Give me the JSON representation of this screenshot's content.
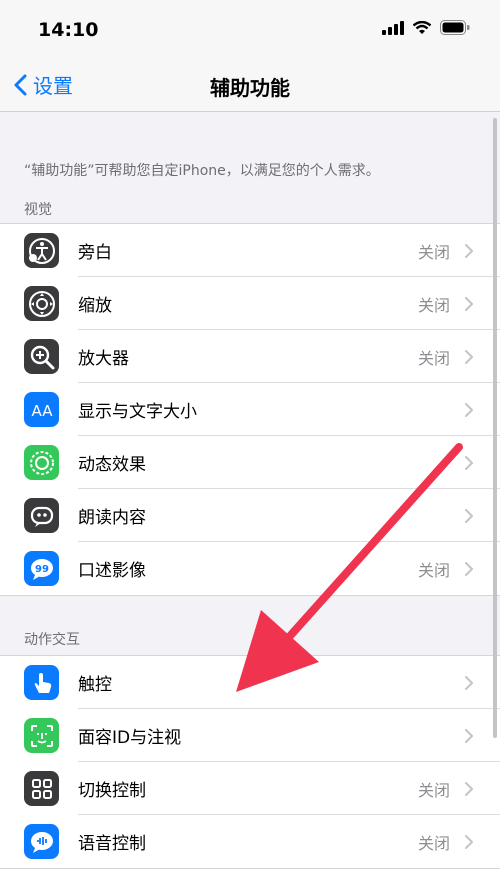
{
  "status_bar": {
    "time": "14:10"
  },
  "nav": {
    "back_label": "设置",
    "title": "辅助功能"
  },
  "description": "“辅助功能”可帮助您自定iPhone，以满足您的个人需求。",
  "sections": [
    {
      "header": "视觉",
      "items": [
        {
          "label": "旁白",
          "value": "关闭",
          "icon": "voiceover-icon",
          "color": "#3a3a3c"
        },
        {
          "label": "缩放",
          "value": "关闭",
          "icon": "zoom-icon",
          "color": "#3a3a3c"
        },
        {
          "label": "放大器",
          "value": "关闭",
          "icon": "magnifier-icon",
          "color": "#3a3a3c"
        },
        {
          "label": "显示与文字大小",
          "value": "",
          "icon": "text-size-icon",
          "color": "#0a7aff"
        },
        {
          "label": "动态效果",
          "value": "",
          "icon": "motion-icon",
          "color": "#34c759"
        },
        {
          "label": "朗读内容",
          "value": "",
          "icon": "spoken-content-icon",
          "color": "#3a3a3c"
        },
        {
          "label": "口述影像",
          "value": "关闭",
          "icon": "audio-description-icon",
          "color": "#0a7aff"
        }
      ]
    },
    {
      "header": "动作交互",
      "items": [
        {
          "label": "触控",
          "value": "",
          "icon": "touch-icon",
          "color": "#0a7aff"
        },
        {
          "label": "面容ID与注视",
          "value": "",
          "icon": "face-id-icon",
          "color": "#34c759"
        },
        {
          "label": "切换控制",
          "value": "关闭",
          "icon": "switch-control-icon",
          "color": "#3a3a3c"
        },
        {
          "label": "语音控制",
          "value": "关闭",
          "icon": "voice-control-icon",
          "color": "#0a7aff"
        }
      ]
    }
  ],
  "annotation": {
    "arrow_color": "#f0344f"
  }
}
